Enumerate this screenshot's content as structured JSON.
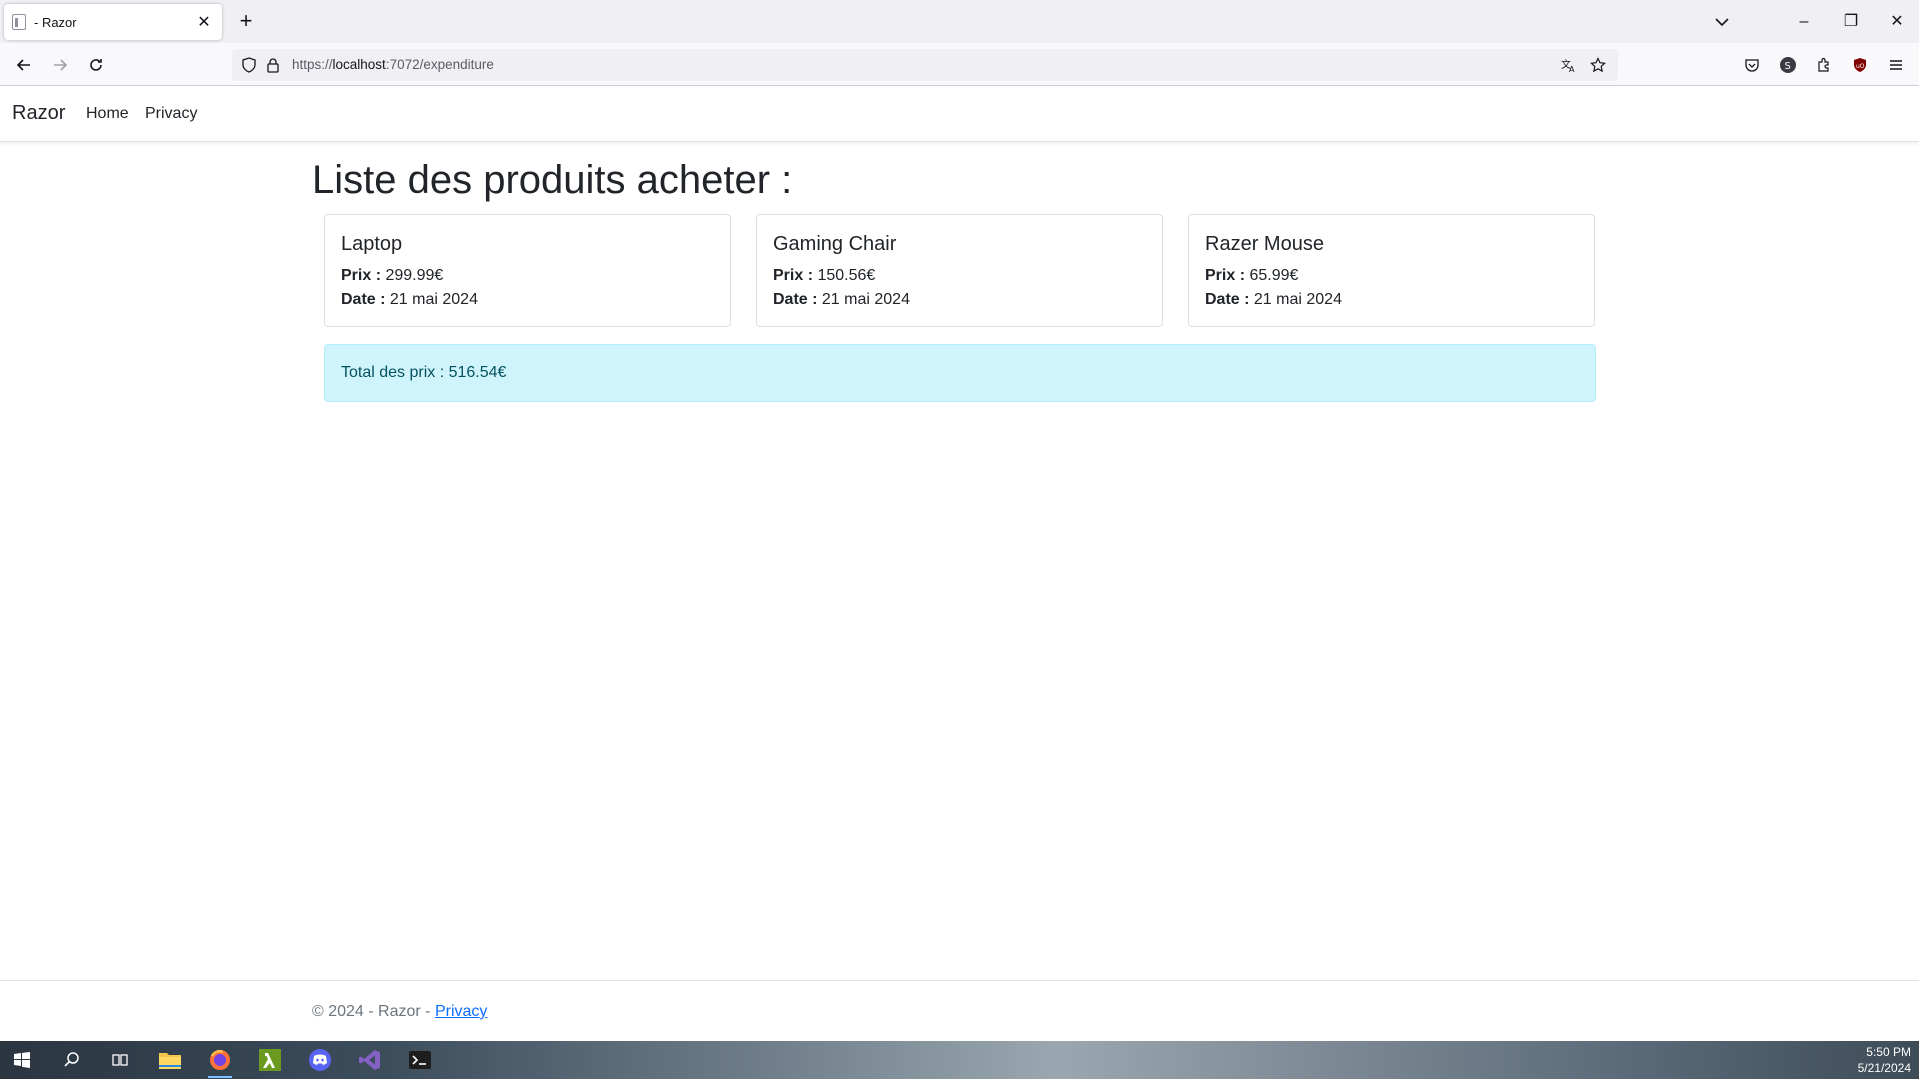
{
  "browser": {
    "tab_title": "- Razor",
    "new_tab_symbol": "+",
    "url_prefix": "https://",
    "url_host": "localhost",
    "url_path": ":7072/expenditure",
    "window_controls": {
      "minimize": "–",
      "restore": "❐",
      "close": "✕"
    },
    "tab_close": "✕"
  },
  "site": {
    "brand": "Razor",
    "nav": [
      "Home",
      "Privacy"
    ]
  },
  "main": {
    "heading": "Liste des produits acheter :",
    "products": [
      {
        "name": "Laptop",
        "price_label": "Prix :",
        "price": " 299.99€",
        "date_label": "Date :",
        "date": " 21 mai 2024"
      },
      {
        "name": "Gaming Chair",
        "price_label": "Prix :",
        "price": " 150.56€",
        "date_label": "Date :",
        "date": " 21 mai 2024"
      },
      {
        "name": "Razer Mouse",
        "price_label": "Prix :",
        "price": " 65.99€",
        "date_label": "Date :",
        "date": " 21 mai 2024"
      }
    ],
    "total": "Total des prix : 516.54€"
  },
  "footer": {
    "text": "© 2024 - Razor - ",
    "link": "Privacy"
  },
  "taskbar": {
    "time": "5:50 PM",
    "date": "5/21/2024",
    "apps": [
      "start-icon",
      "search-icon",
      "task-view-icon",
      "file-explorer-icon",
      "firefox-icon",
      "lambda-app-icon",
      "discord-icon",
      "visual-studio-icon",
      "terminal-icon"
    ]
  },
  "colors": {
    "alert_bg": "#cff4fc",
    "alert_text": "#055160",
    "link": "#0d6efd"
  }
}
